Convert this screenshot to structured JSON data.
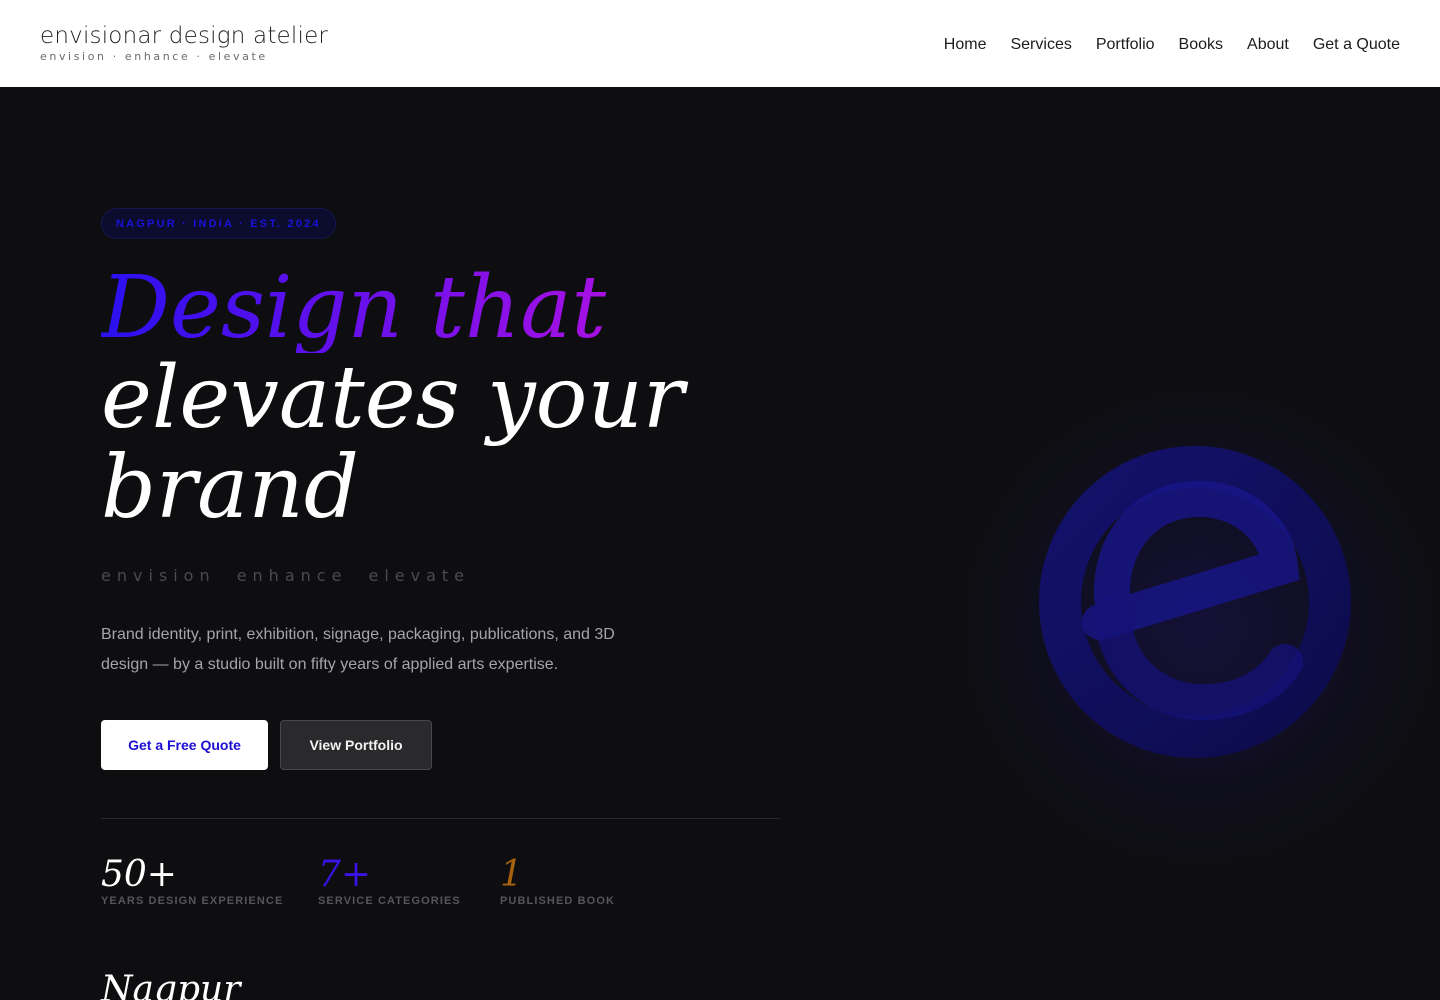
{
  "header": {
    "brand_name": "envisionar design atelier",
    "brand_tagline": "envision · enhance · elevate",
    "nav": [
      {
        "label": "Home"
      },
      {
        "label": "Services"
      },
      {
        "label": "Portfolio"
      },
      {
        "label": "Books"
      },
      {
        "label": "About"
      },
      {
        "label": "Get a Quote"
      }
    ]
  },
  "hero": {
    "badge": "NAGPUR · INDIA · EST. 2024",
    "headline_gradient": "Design that",
    "headline_line2": "elevates your",
    "headline_line3": "brand",
    "tagline": "envision enhance elevate",
    "description": "Brand identity, print, exhibition, signage, packaging, publications, and 3D design — by a studio built on fifty years of applied arts expertise.",
    "primary_button": "Get a Free Quote",
    "secondary_button": "View Portfolio",
    "stats": [
      {
        "value": "50+",
        "label": "YEARS DESIGN EXPERIENCE"
      },
      {
        "value": "7+",
        "label": "SERVICE CATEGORIES"
      },
      {
        "value": "1",
        "label": "PUBLISHED BOOK"
      }
    ],
    "city": "Nagpur"
  },
  "colors": {
    "background": "#0e0e10",
    "accent_blue": "#1a0fd2",
    "accent_magenta": "#e010d8",
    "accent_gold": "#a8620f"
  },
  "icons": {
    "emblem": "e-logo-icon"
  }
}
